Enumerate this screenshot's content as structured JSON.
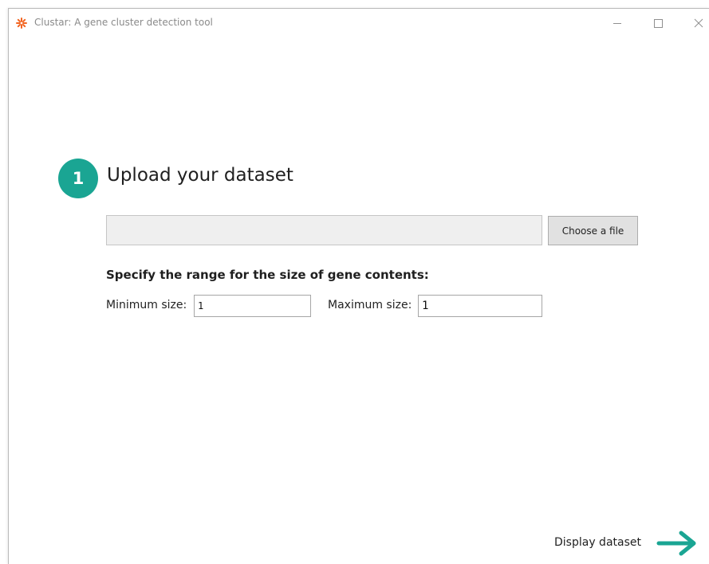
{
  "window": {
    "title": "Clustar: A gene cluster detection tool",
    "controls": {
      "minimize_icon": "minimize-icon",
      "maximize_icon": "maximize-icon",
      "close_icon": "close-icon"
    },
    "app_icon": "clustar-star-icon",
    "app_icon_color": "#f26522"
  },
  "step": {
    "number": "1",
    "title": "Upload your dataset",
    "badge_color": "#1aa593"
  },
  "upload": {
    "file_path_value": "",
    "file_path_placeholder": "",
    "choose_button_label": "Choose a file"
  },
  "range": {
    "heading": "Specify the range for the size of gene contents:",
    "min_label": "Minimum size:",
    "min_value": "1",
    "max_label": "Maximum size:",
    "max_value": "1"
  },
  "footer": {
    "next_label": "Display dataset",
    "next_icon": "arrow-right-icon",
    "arrow_color": "#1aa593"
  }
}
